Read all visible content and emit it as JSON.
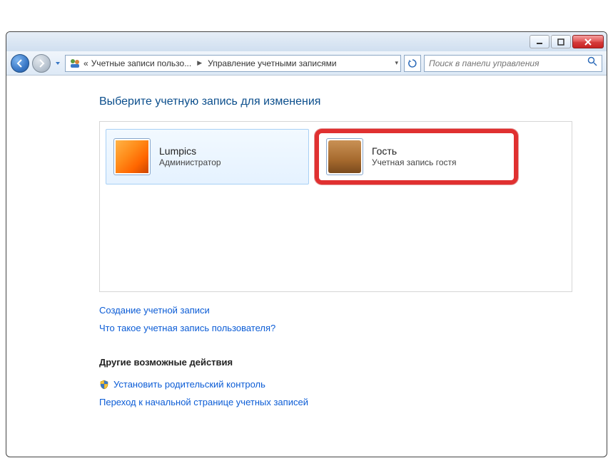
{
  "breadcrumb": {
    "prefix": "«",
    "seg1": "Учетные записи пользо...",
    "seg2": "Управление учетными записями"
  },
  "search": {
    "placeholder": "Поиск в панели управления"
  },
  "page_title": "Выберите учетную запись для изменения",
  "accounts": [
    {
      "name": "Lumpics",
      "role": "Администратор"
    },
    {
      "name": "Гость",
      "role": "Учетная запись гостя"
    }
  ],
  "links": {
    "create_account": "Создание учетной записи",
    "what_is_account": "Что такое учетная запись пользователя?",
    "other_actions_header": "Другие возможные действия",
    "parental_control": "Установить родительский контроль",
    "go_home": "Переход к начальной странице учетных записей"
  }
}
